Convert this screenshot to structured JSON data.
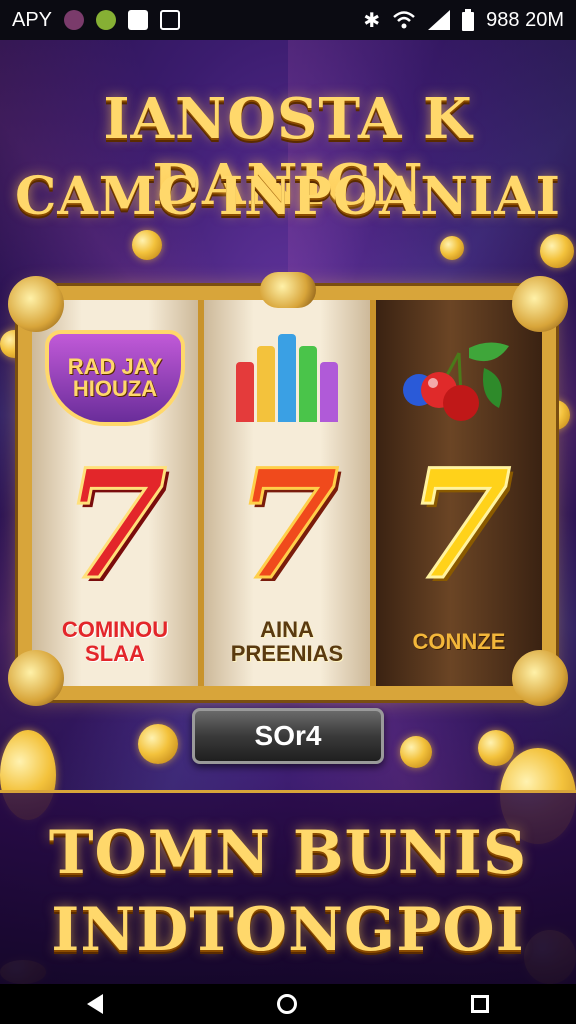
{
  "status_bar": {
    "left_text": "APY",
    "right_text": "988 20M",
    "icons": [
      "notification-dot-icon",
      "lemon-app-icon",
      "sim-card-icon",
      "camera-icon",
      "bluetooth-icon",
      "wifi-icon",
      "signal-icon",
      "battery-icon"
    ]
  },
  "header": {
    "title_line1": "IANOSTA K DANICN",
    "title_line2": "CAMC INPOANIAI"
  },
  "slot_machine": {
    "reels": [
      {
        "top_symbol": "badge",
        "badge_text": "RAD JAY HIOUZA",
        "seven": "7",
        "label_line1": "COMINOU",
        "label_line2": "SLAA"
      },
      {
        "top_symbol": "bars",
        "seven": "7",
        "label_line1": "AINA",
        "label_line2": "PREENIAS"
      },
      {
        "top_symbol": "cherries",
        "seven": "7",
        "label_line1": "CONNZE",
        "label_line2": ""
      }
    ]
  },
  "spin_button": {
    "label": "SOr4"
  },
  "footer": {
    "title_line1": "TOMN BUNIS",
    "title_line2": "INDTONGPOI"
  },
  "colors": {
    "gold": "#ffd86b",
    "frame": "#d8a53a",
    "background": "#3b1c6e"
  }
}
